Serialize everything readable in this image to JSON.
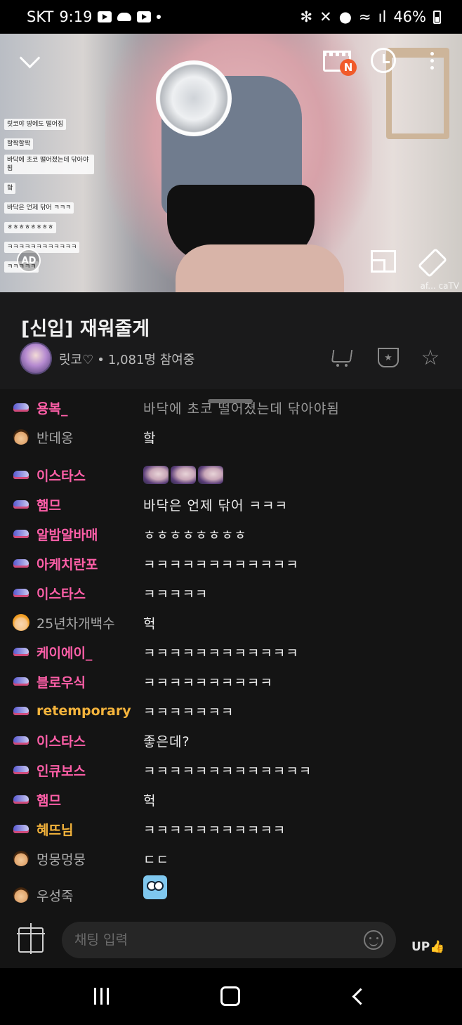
{
  "status_bar": {
    "carrier": "SKT",
    "time": "9:19",
    "battery": "46%"
  },
  "video": {
    "ad_label": "AD",
    "new_badge": "N",
    "watermark": "af... caTV",
    "overlay_chat": [
      "릿코야 땅에도 떨어짐",
      "할짝할짝",
      "바닥에 초코 떨어졌는데 닦아야됨",
      "핰",
      "바닥은 언제 닦어 ㅋㅋㅋ",
      "ㅎㅎㅎㅎㅎㅎㅎㅎ",
      "ㅋㅋㅋㅋㅋㅋㅋㅋㅋㅋㅋㅋ",
      "ㅋㅋㅋㅋㅋ"
    ]
  },
  "broadcast": {
    "title": "[신입] 재워줄게",
    "streamer": "릿코♡",
    "separator": "•",
    "viewers": "1,081명 참여중"
  },
  "chat": [
    {
      "nick": "용복_",
      "style": "pink",
      "badge": "fan",
      "msg": "바닥에 초코 떨어졌는데 닦아야됨",
      "faded": true
    },
    {
      "nick": "반데옹",
      "style": "normal",
      "badge": "face",
      "msg": "핰"
    },
    {
      "nick": "이스타스",
      "style": "pink",
      "badge": "fan",
      "emotes": 3
    },
    {
      "nick": "햄므",
      "style": "pink",
      "badge": "fan",
      "msg": "바닥은 언제 닦어 ㅋㅋㅋ"
    },
    {
      "nick": "알밤알바매",
      "style": "pink",
      "badge": "fan",
      "msg": "ㅎㅎㅎㅎㅎㅎㅎㅎ"
    },
    {
      "nick": "아케치란포",
      "style": "pink",
      "badge": "fan",
      "msg": "ㅋㅋㅋㅋㅋㅋㅋㅋㅋㅋㅋㅋ"
    },
    {
      "nick": "이스타스",
      "style": "pink",
      "badge": "fan",
      "msg": "ㅋㅋㅋㅋㅋ"
    },
    {
      "nick": "25년차개백수",
      "style": "normal",
      "badge": "girl",
      "msg": "헉"
    },
    {
      "nick": "케이에이_",
      "style": "pink",
      "badge": "fan",
      "msg": "ㅋㅋㅋㅋㅋㅋㅋㅋㅋㅋㅋㅋ"
    },
    {
      "nick": "블로우식",
      "style": "pink",
      "badge": "fan",
      "msg": "ㅋㅋㅋㅋㅋㅋㅋㅋㅋㅋ"
    },
    {
      "nick": "retemporary",
      "style": "gold",
      "badge": "fan",
      "msg": "ㅋㅋㅋㅋㅋㅋㅋ"
    },
    {
      "nick": "이스타스",
      "style": "pink",
      "badge": "fan",
      "msg": "좋은데?"
    },
    {
      "nick": "인큐보스",
      "style": "pink",
      "badge": "fan",
      "msg": "ㅋㅋㅋㅋㅋㅋㅋㅋㅋㅋㅋㅋㅋ"
    },
    {
      "nick": "햄므",
      "style": "pink",
      "badge": "fan",
      "msg": "헉"
    },
    {
      "nick": "혜뜨님",
      "style": "gold",
      "badge": "fan",
      "msg": "ㅋㅋㅋㅋㅋㅋㅋㅋㅋㅋㅋ"
    },
    {
      "nick": "멍뭉멍뭉",
      "style": "normal",
      "badge": "face",
      "msg": "ㄷㄷ"
    },
    {
      "nick": "우성죽",
      "style": "normal",
      "badge": "face",
      "owl": true
    }
  ],
  "input": {
    "placeholder": "채팅 입력",
    "up_label": "UP"
  }
}
